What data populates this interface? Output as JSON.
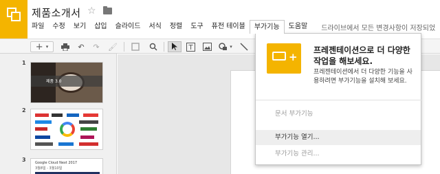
{
  "header": {
    "doc_title": "제품소개서",
    "icons": [
      "slides-logo-icon",
      "star-icon",
      "folder-icon"
    ]
  },
  "menu": {
    "items": [
      "파일",
      "수정",
      "보기",
      "삽입",
      "슬라이드",
      "서식",
      "정렬",
      "도구",
      "퓨전 테이블",
      "부가기능",
      "도움말"
    ],
    "notice": "드라이브에서 모든 변경사항이 저장되었"
  },
  "toolbar": {
    "icons": [
      "new-slide-icon",
      "dropdown-icon",
      "print-icon",
      "undo-icon",
      "redo-icon",
      "paint-format-icon",
      "zoom-fit-icon",
      "zoom-icon",
      "select-icon",
      "text-box-icon",
      "image-icon",
      "shape-icon",
      "line-icon"
    ]
  },
  "slides": {
    "numbers": [
      "1",
      "2",
      "3"
    ],
    "thumb1_caption": "제품 3.0",
    "thumb3_title": "Google Cloud Next 2017",
    "thumb3_subtitle": "3월8일 - 3월10일"
  },
  "addons_menu": {
    "promo_title": "프레젠테이션으로 더 다양한 작업을 해보세요.",
    "promo_text": "프레젠테이션에서 더 다양한 기능을 사용하려면 부가기능을 설치해 보세요.",
    "items": [
      {
        "label": "문서 부가기능",
        "enabled": false
      },
      {
        "label": "부가기능 열기...",
        "enabled": true
      },
      {
        "label": "부가기능 관리...",
        "enabled": false
      }
    ]
  },
  "colors": {
    "brand": "#f4b400",
    "accent_orange": "#f4a340"
  }
}
